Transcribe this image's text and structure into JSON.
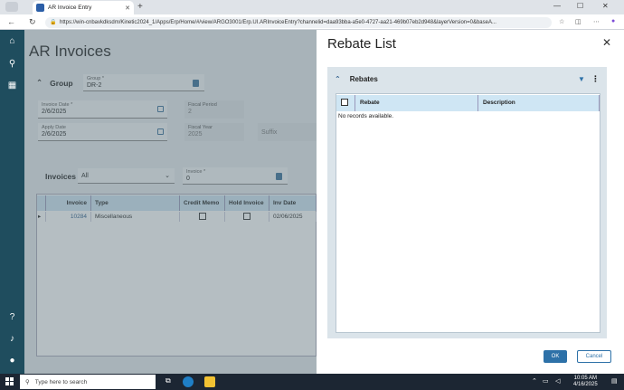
{
  "browser": {
    "tab_title": "AR Invoice Entry",
    "url": "https://win-cnbavkdksdm/Kinetic2024_1/Apps/Erp/Home/#/view/ARGO3001/Erp.UI.ARInvoiceEntry?channelid=daa93bba-a5e0-4727-aa21-469b07eb2d948&layerVersion=0&baseA..."
  },
  "main": {
    "title": "AR Invoices",
    "group_panel": "Group",
    "group_field": {
      "label": "Group *",
      "value": "DR-2"
    },
    "invoice_date": {
      "label": "Invoice Date *",
      "value": "2/6/2025"
    },
    "apply_date": {
      "label": "Apply Date",
      "value": "2/6/2025"
    },
    "fiscal_period": {
      "label": "Fiscal Period",
      "value": "2"
    },
    "fiscal_year": {
      "label": "Fiscal Year",
      "value": "2025"
    },
    "suffix": {
      "label": "Suffix"
    },
    "invoices_label": "Invoices",
    "filter_value": "All",
    "invoice_field": {
      "label": "Invoice *",
      "value": "0"
    },
    "grid": {
      "columns": [
        "Invoice",
        "Type",
        "Credit Memo",
        "Hold Invoice",
        "Inv Date"
      ],
      "rows": [
        {
          "invoice": "10284",
          "type": "Miscellaneous",
          "inv_date": "02/06/2025"
        }
      ]
    }
  },
  "slideout": {
    "title": "Rebate List",
    "panel_title": "Rebates",
    "columns": [
      "Rebate",
      "Description"
    ],
    "empty_text": "No records available.",
    "ok_label": "OK",
    "cancel_label": "Cancel"
  },
  "taskbar": {
    "search_placeholder": "Type here to search",
    "time": "10:05 AM",
    "date": "4/16/2025"
  }
}
